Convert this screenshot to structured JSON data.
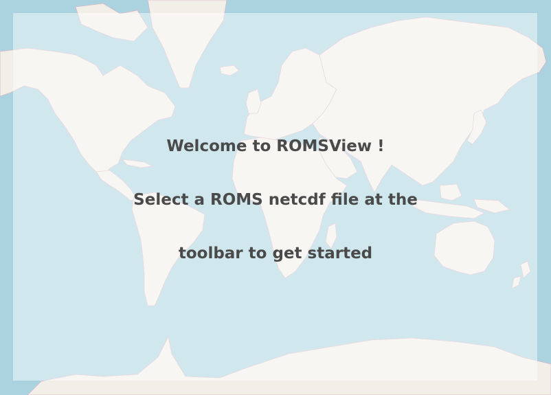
{
  "map": {
    "water_color": "#aad3df",
    "land_color": "#f2efe9",
    "border_color": "#d9b7c6",
    "overlay_color": "rgba(255,255,255,0.45)"
  },
  "welcome": {
    "line1": "Welcome to ROMSView !",
    "line2": "Select a ROMS netcdf file at the",
    "line3": "toolbar to get started",
    "text_color": "#4a4a4a"
  }
}
